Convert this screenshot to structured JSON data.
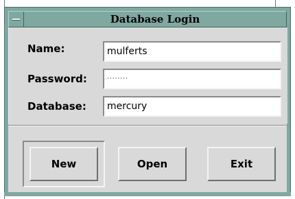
{
  "window": {
    "title": "Database Login"
  },
  "form": {
    "name_label": "Name:",
    "name_value": "mulferts",
    "password_label": "Password:",
    "password_value": "········",
    "database_label": "Database:",
    "database_value": "mercury"
  },
  "buttons": {
    "new_label": "New",
    "open_label": "Open",
    "exit_label": "Exit"
  },
  "colors": {
    "titlebar": "#7fa8a0",
    "panel": "#d9d9d9",
    "input_bg": "#ffffff"
  }
}
